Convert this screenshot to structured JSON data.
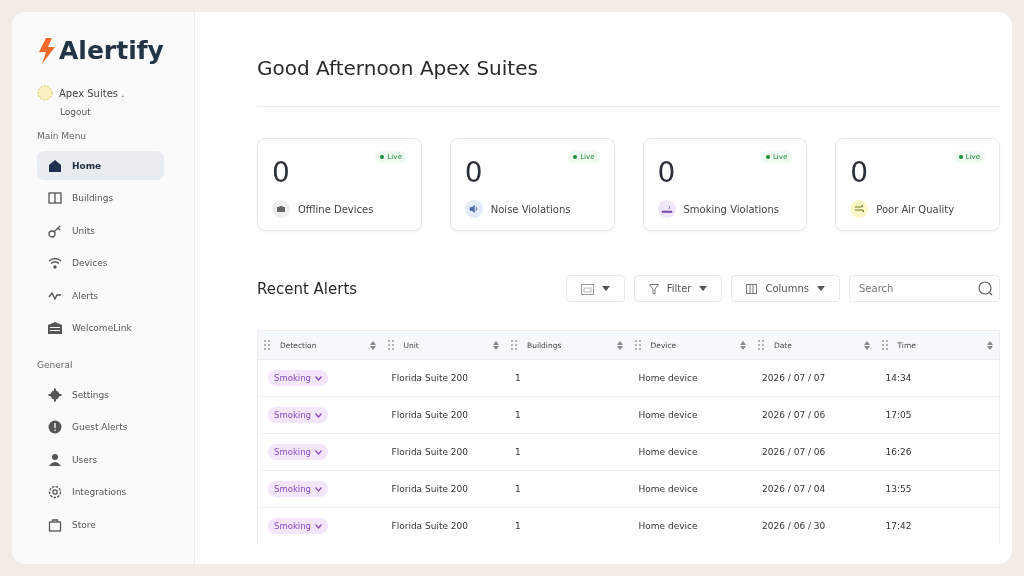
{
  "brand": {
    "name": "Alertify"
  },
  "account": {
    "name": "Apex Suites .",
    "logout": "Logout"
  },
  "sidebar": {
    "sections": [
      {
        "title": "Main Menu",
        "items": [
          {
            "label": "Home",
            "kind": "home",
            "selected": true
          },
          {
            "label": "Buildings",
            "kind": "columns",
            "selected": false
          },
          {
            "label": "Units",
            "kind": "key",
            "selected": false
          },
          {
            "label": "Devices",
            "kind": "wifi",
            "selected": false
          },
          {
            "label": "Alerts",
            "kind": "pulse",
            "selected": false
          },
          {
            "label": "WelcomeLink",
            "kind": "garage",
            "selected": false
          }
        ]
      },
      {
        "title": "General",
        "items": [
          {
            "label": "Settings",
            "kind": "gear",
            "selected": false
          },
          {
            "label": "Guest Alerts",
            "kind": "alert",
            "selected": false
          },
          {
            "label": "Users",
            "kind": "user",
            "selected": false
          },
          {
            "label": "Integrations",
            "kind": "cog",
            "selected": false
          },
          {
            "label": "Store",
            "kind": "bag",
            "selected": false
          }
        ]
      }
    ]
  },
  "greeting": "Good Afternoon Apex Suites",
  "stats": [
    {
      "value": "0",
      "label": "Offline Devices",
      "badge": "Live",
      "kind": "camera",
      "color": "#eeeeee"
    },
    {
      "value": "0",
      "label": "Noise Violations",
      "badge": "Live",
      "kind": "speaker",
      "color": "#e3ebfb"
    },
    {
      "value": "0",
      "label": "Smoking Violations",
      "badge": "Live",
      "kind": "smoke",
      "color": "#efe6fa"
    },
    {
      "value": "0",
      "label": "Poor Air Quality",
      "badge": "Live",
      "kind": "wind",
      "color": "#fbf7c8"
    }
  ],
  "alerts": {
    "title": "Recent Alerts",
    "filter": "Filter",
    "columns_button": "Columns",
    "search": {
      "placeholder": "Search"
    },
    "columns": [
      "Detection",
      "Unit",
      "Buildings",
      "Device",
      "Date",
      "Time"
    ],
    "rows": [
      {
        "detection": "Smoking",
        "unit": "Florida Suite 200",
        "building": "1",
        "device": "Home device",
        "date": "2026 / 07 / 07",
        "time": "14:34"
      },
      {
        "detection": "Smoking",
        "unit": "Florida Suite 200",
        "building": "1",
        "device": "Home device",
        "date": "2026 / 07 / 06",
        "time": "17:05"
      },
      {
        "detection": "Smoking",
        "unit": "Florida Suite 200",
        "building": "1",
        "device": "Home device",
        "date": "2026 / 07 / 06",
        "time": "16:26"
      },
      {
        "detection": "Smoking",
        "unit": "Florida Suite 200",
        "building": "1",
        "device": "Home device",
        "date": "2026 / 07 / 04",
        "time": "13:55"
      },
      {
        "detection": "Smoking",
        "unit": "Florida Suite 200",
        "building": "1",
        "device": "Home device",
        "date": "2026 / 06 / 30",
        "time": "17:42"
      }
    ]
  }
}
